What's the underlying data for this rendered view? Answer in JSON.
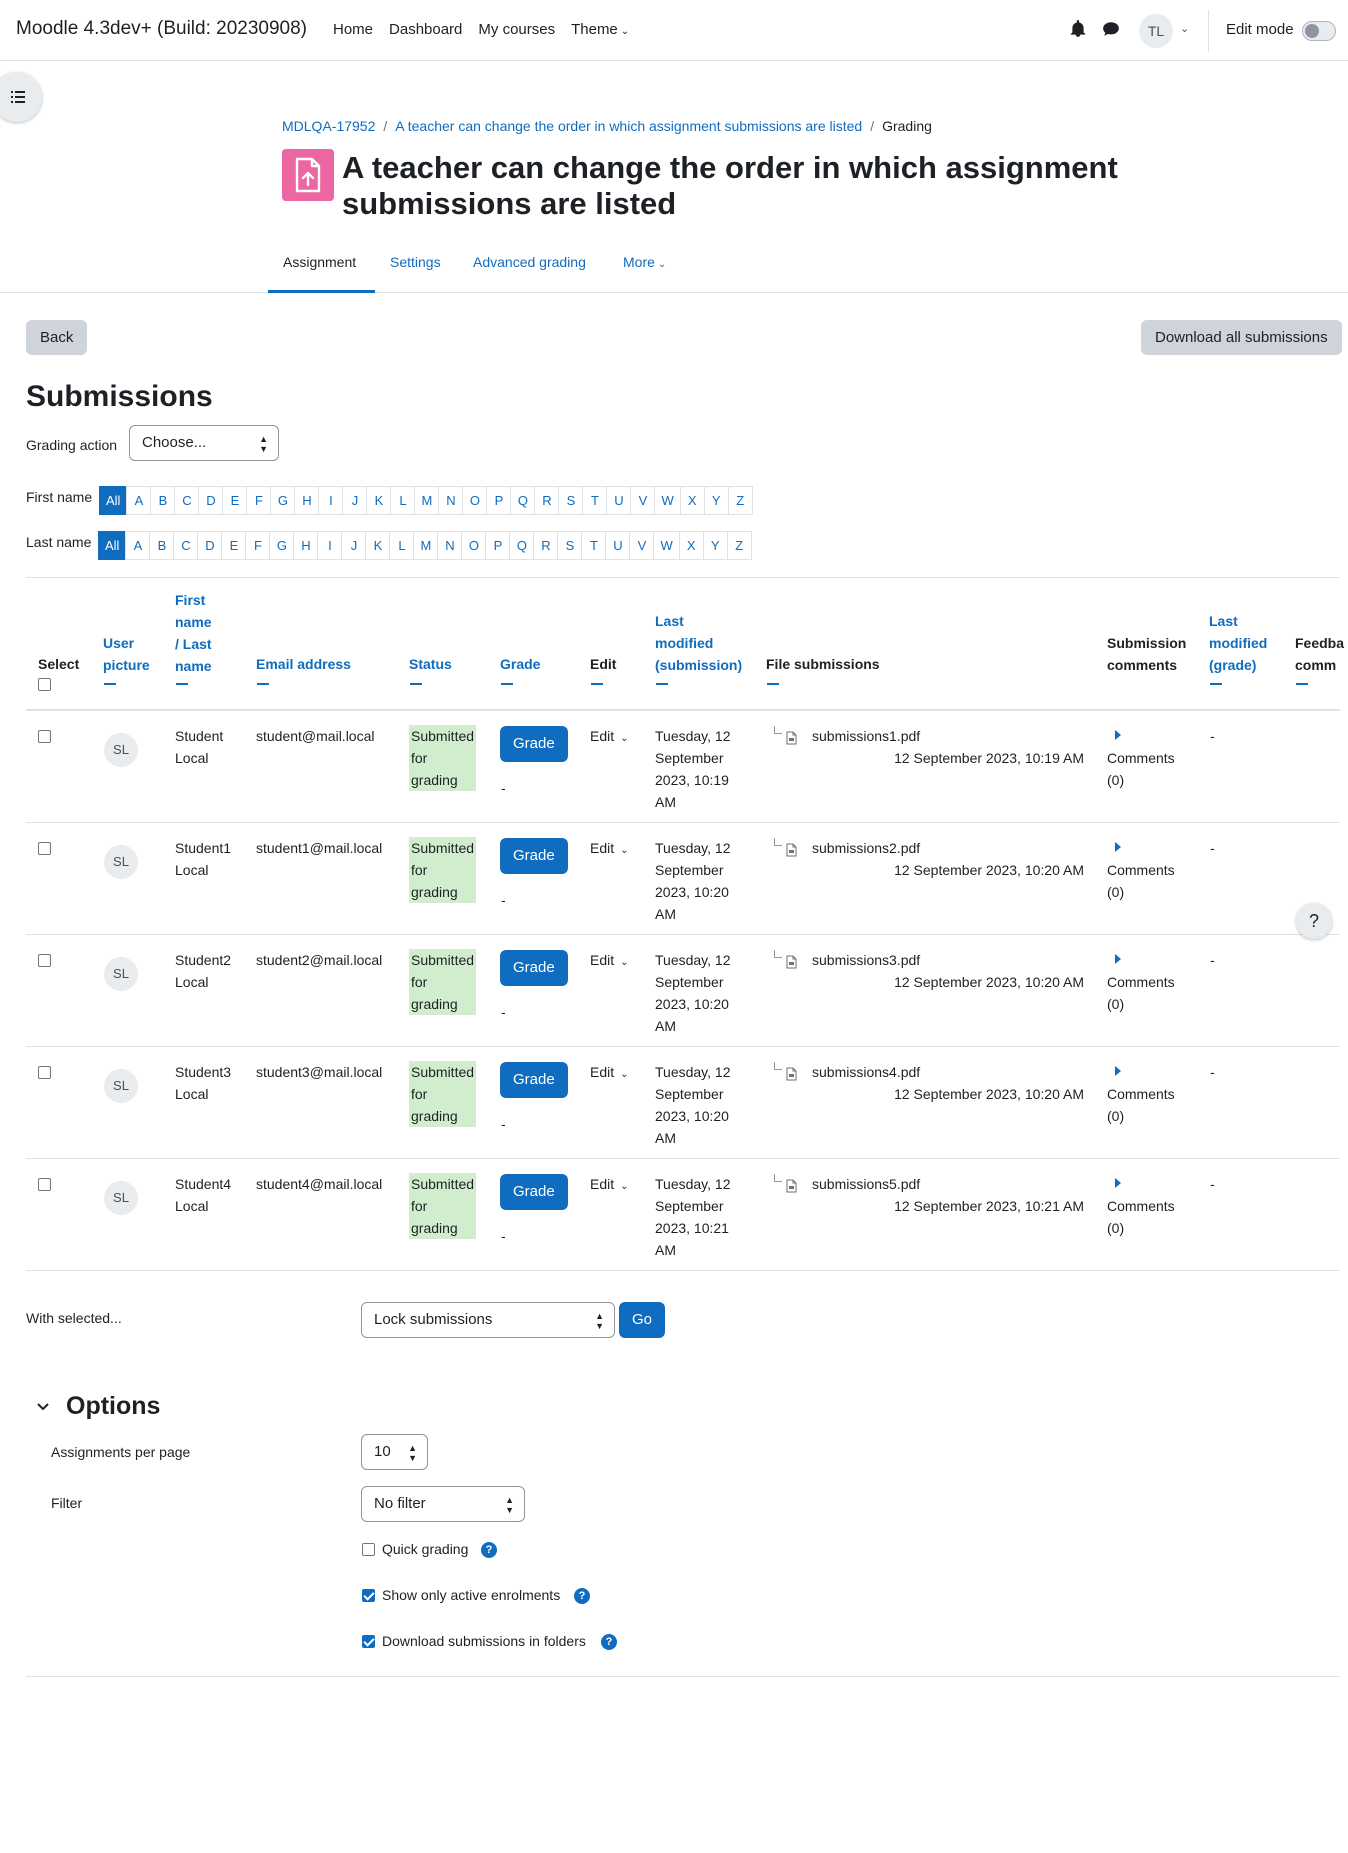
{
  "navbar": {
    "brand": "Moodle 4.3dev+ (Build: 20230908)",
    "links": [
      "Home",
      "Dashboard",
      "My courses",
      "Theme"
    ],
    "theme_caret": "⌄",
    "user_initials": "TL",
    "edit_mode_label": "Edit mode"
  },
  "breadcrumb": {
    "course": "MDLQA-17952",
    "activity": "A teacher can change the order in which assignment submissions are listed",
    "current": "Grading",
    "separator": "/"
  },
  "page_title": "A teacher can change the order in which assignment submissions are listed",
  "secondary_nav": {
    "items": [
      "Assignment",
      "Settings",
      "Advanced grading",
      "More"
    ],
    "more_caret": "⌄"
  },
  "buttons": {
    "back": "Back",
    "download_all": "Download all submissions",
    "go": "Go"
  },
  "submissions_heading": "Submissions",
  "grading_action": {
    "label": "Grading action",
    "value": "Choose..."
  },
  "initials_bar": {
    "first_name_label": "First name",
    "last_name_label": "Last name",
    "all_label": "All",
    "letters": [
      "A",
      "B",
      "C",
      "D",
      "E",
      "F",
      "G",
      "H",
      "I",
      "J",
      "K",
      "L",
      "M",
      "N",
      "O",
      "P",
      "Q",
      "R",
      "S",
      "T",
      "U",
      "V",
      "W",
      "X",
      "Y",
      "Z"
    ]
  },
  "table": {
    "headers": {
      "select": "Select",
      "user_picture_1": "User",
      "user_picture_2": "picture",
      "first_1": "First",
      "first_2": "name",
      "slash_last": "/ Last",
      "last_name": "name",
      "email": "Email address",
      "status": "Status",
      "grade": "Grade",
      "edit": "Edit",
      "last_mod_1": "Last",
      "last_mod_2": "modified",
      "last_mod_3": "(submission)",
      "file_submissions": "File submissions",
      "comments_1": "Submission",
      "comments_2": "comments",
      "lmg_1": "Last",
      "lmg_2": "modified",
      "lmg_3": "(grade)",
      "feedback_1": "Feedba",
      "feedback_2": "comm"
    },
    "rows": [
      {
        "initials": "SL",
        "first": "Student",
        "last": "Local",
        "email": "student@mail.local",
        "status": [
          "Submitted",
          "for",
          "grading"
        ],
        "grade_button": "Grade",
        "grade_value": "-",
        "edit": "Edit",
        "modified": [
          "Tuesday, 12",
          "September",
          "2023, 10:19",
          "AM"
        ],
        "file": "submissions1.pdf",
        "file_date": "12 September 2023, 10:19 AM",
        "comments": "Comments",
        "comments_count": "(0)",
        "grade_modified": "-"
      },
      {
        "initials": "SL",
        "first": "Student1",
        "last": "Local",
        "email": "student1@mail.local",
        "status": [
          "Submitted",
          "for",
          "grading"
        ],
        "grade_button": "Grade",
        "grade_value": "-",
        "edit": "Edit",
        "modified": [
          "Tuesday, 12",
          "September",
          "2023, 10:20",
          "AM"
        ],
        "file": "submissions2.pdf",
        "file_date": "12 September 2023, 10:20 AM",
        "comments": "Comments",
        "comments_count": "(0)",
        "grade_modified": "-"
      },
      {
        "initials": "SL",
        "first": "Student2",
        "last": "Local",
        "email": "student2@mail.local",
        "status": [
          "Submitted",
          "for",
          "grading"
        ],
        "grade_button": "Grade",
        "grade_value": "-",
        "edit": "Edit",
        "modified": [
          "Tuesday, 12",
          "September",
          "2023, 10:20",
          "AM"
        ],
        "file": "submissions3.pdf",
        "file_date": "12 September 2023, 10:20 AM",
        "comments": "Comments",
        "comments_count": "(0)",
        "grade_modified": "-"
      },
      {
        "initials": "SL",
        "first": "Student3",
        "last": "Local",
        "email": "student3@mail.local",
        "status": [
          "Submitted",
          "for",
          "grading"
        ],
        "grade_button": "Grade",
        "grade_value": "-",
        "edit": "Edit",
        "modified": [
          "Tuesday, 12",
          "September",
          "2023, 10:20",
          "AM"
        ],
        "file": "submissions4.pdf",
        "file_date": "12 September 2023, 10:20 AM",
        "comments": "Comments",
        "comments_count": "(0)",
        "grade_modified": "-"
      },
      {
        "initials": "SL",
        "first": "Student4",
        "last": "Local",
        "email": "student4@mail.local",
        "status": [
          "Submitted",
          "for",
          "grading"
        ],
        "grade_button": "Grade",
        "grade_value": "-",
        "edit": "Edit",
        "modified": [
          "Tuesday, 12",
          "September",
          "2023, 10:21",
          "AM"
        ],
        "file": "submissions5.pdf",
        "file_date": "12 September 2023, 10:21 AM",
        "comments": "Comments",
        "comments_count": "(0)",
        "grade_modified": "-"
      }
    ]
  },
  "bulk": {
    "label": "With selected...",
    "action": "Lock submissions"
  },
  "options": {
    "title": "Options",
    "per_page_label": "Assignments per page",
    "per_page_value": "10",
    "filter_label": "Filter",
    "filter_value": "No filter",
    "quick_grading": "Quick grading",
    "active_enrolments": "Show only active enrolments",
    "download_folders": "Download submissions in folders"
  },
  "help_icon_glyph": "?",
  "select_arrows_glyph": "▲▼",
  "colors": {
    "primary": "#0f6cbf",
    "status_submitted_bg": "#d2edcd",
    "activity_icon_bg": "#eb66a2"
  }
}
